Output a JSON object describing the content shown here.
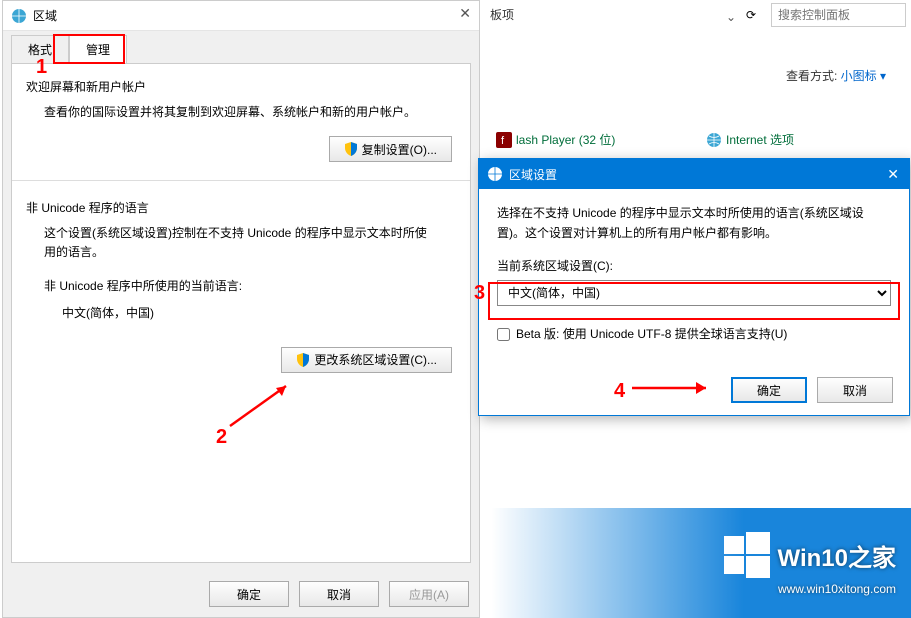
{
  "control_panel": {
    "breadcrumb": "板项",
    "search_placeholder": "搜索控制面板",
    "view_by_label": "查看方式:",
    "view_by_value": "小图标 ▾",
    "items": {
      "flash": "lash Player (32 位)",
      "internet": "Internet 选项"
    },
    "refresh": "⟳"
  },
  "region_dialog": {
    "title": "区域",
    "tabs": {
      "format": "格式",
      "admin": "管理"
    },
    "welcome": {
      "title": "欢迎屏幕和新用户帐户",
      "desc": "查看你的国际设置并将其复制到欢迎屏幕、系统帐户和新的用户帐户。",
      "button": "复制设置(O)..."
    },
    "nonunicode": {
      "title": "非 Unicode 程序的语言",
      "desc": "这个设置(系统区域设置)控制在不支持 Unicode 的程序中显示文本时所使用的语言。",
      "current_label": "非 Unicode 程序中所使用的当前语言:",
      "current_value": "中文(简体，中国)",
      "button": "更改系统区域设置(C)..."
    },
    "footer": {
      "ok": "确定",
      "cancel": "取消",
      "apply": "应用(A)"
    }
  },
  "region_settings": {
    "title": "区域设置",
    "desc": "选择在不支持 Unicode 的程序中显示文本时所使用的语言(系统区域设置)。这个设置对计算机上的所有用户帐户都有影响。",
    "current_label": "当前系统区域设置(C):",
    "select_value": "中文(简体，中国)",
    "beta_label": "Beta 版: 使用 Unicode UTF-8 提供全球语言支持(U)",
    "ok": "确定",
    "cancel": "取消"
  },
  "annotations": {
    "n1": "1",
    "n2": "2",
    "n3": "3",
    "n4": "4"
  },
  "watermark": {
    "brand": "Win10之家",
    "url": "www.win10xitong.com"
  }
}
